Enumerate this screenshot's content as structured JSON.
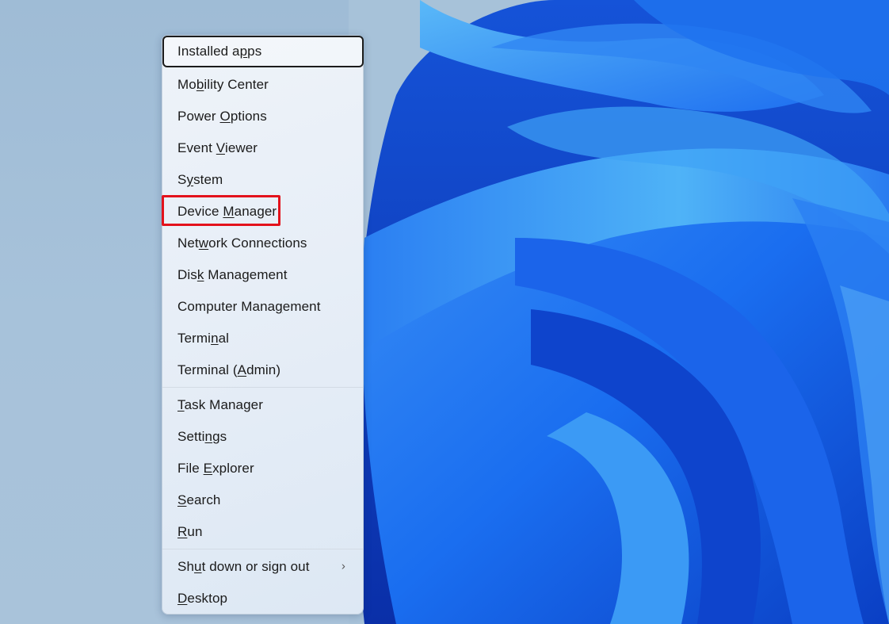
{
  "menu": {
    "items": [
      {
        "label": "Installed apps",
        "access_key_index": 11,
        "focused": true
      },
      {
        "label": "Mobility Center",
        "access_key_index": 2
      },
      {
        "label": "Power Options",
        "access_key_index": 6
      },
      {
        "label": "Event Viewer",
        "access_key_index": 6
      },
      {
        "label": "System",
        "access_key_index": 1
      },
      {
        "label": "Device Manager",
        "access_key_index": 7,
        "highlighted": true
      },
      {
        "label": "Network Connections",
        "access_key_index": 3
      },
      {
        "label": "Disk Management",
        "access_key_index": 3
      },
      {
        "label": "Computer Management",
        "access_key_index": 13
      },
      {
        "label": "Terminal",
        "access_key_index": 5
      },
      {
        "label": "Terminal (Admin)",
        "access_key_index": 10
      },
      {
        "separator": true
      },
      {
        "label": "Task Manager",
        "access_key_index": 0
      },
      {
        "label": "Settings",
        "access_key_index": 5
      },
      {
        "label": "File Explorer",
        "access_key_index": 5
      },
      {
        "label": "Search",
        "access_key_index": 0
      },
      {
        "label": "Run",
        "access_key_index": 0
      },
      {
        "separator": true
      },
      {
        "label": "Shut down or sign out",
        "access_key_index": 2,
        "submenu": true,
        "submenu_icon": "chevron-right-icon"
      },
      {
        "label": "Desktop",
        "access_key_index": 0
      }
    ]
  },
  "annotation": {
    "color": "#e3121c",
    "target": "Device Manager"
  },
  "colors": {
    "desktop_bg": "#a3bfd8",
    "wallpaper_primary": "#1a6ef0",
    "wallpaper_light": "#4fb3f7",
    "wallpaper_dark": "#0a2fa8"
  }
}
